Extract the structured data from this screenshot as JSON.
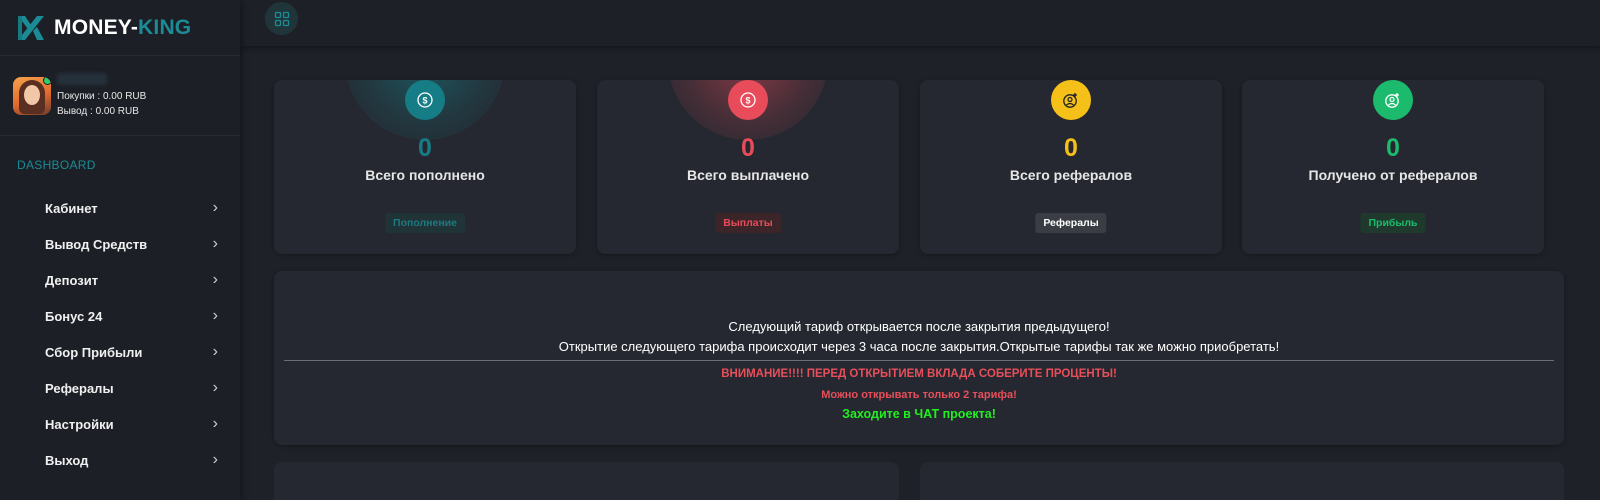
{
  "brand": {
    "name_main": "MONEY-",
    "name_accent": "KING"
  },
  "user": {
    "purchases": "Покупки : 0.00 RUB",
    "withdraw": "Вывод : 0.00 RUB"
  },
  "sidebar": {
    "section_title": "DASHBOARD",
    "items": [
      {
        "label": "Кабинет"
      },
      {
        "label": "Вывод Средств"
      },
      {
        "label": "Депозит"
      },
      {
        "label": "Бонус 24"
      },
      {
        "label": "Сбор Прибыли"
      },
      {
        "label": "Рефералы"
      },
      {
        "label": "Настройки"
      },
      {
        "label": "Выход"
      }
    ],
    "chevron": "›"
  },
  "topbar": {
    "icon": "grid-icon"
  },
  "stats": [
    {
      "value": "0",
      "label": "Всего пополнено",
      "button": "Пополнение",
      "icon": "dollar-coin-icon",
      "color": "#167d86"
    },
    {
      "value": "0",
      "label": "Всего выплачено",
      "button": "Выплаты",
      "icon": "dollar-coin-icon",
      "color": "#e84c5a"
    },
    {
      "value": "0",
      "label": "Всего рефералов",
      "button": "Рефералы",
      "icon": "user-add-icon",
      "color": "#f5c118"
    },
    {
      "value": "0",
      "label": "Получено от рефералов",
      "button": "Прибыль",
      "icon": "user-add-icon",
      "color": "#1cba6c"
    }
  ],
  "notice": {
    "line1": "Следующий тариф открывается после закрытия предыдущего!",
    "line2": "Открытие следующего тарифа происходит через 3 часа после закрытия.Открытые тарифы так же можно приобретать!",
    "warning1": "ВНИМАНИЕ!!!! ПЕРЕД ОТКРЫТИЕМ ВКЛАДА СОБЕРИТЕ ПРОЦЕНТЫ!",
    "warning2": "Можно открывать только 2 тарифа!",
    "chat": "Заходите в ЧАТ проекта!"
  },
  "colors": {
    "accent": "#1b8c95",
    "warning": "#e74f5a",
    "chat": "#22ee22",
    "background": "#1d2027",
    "card": "#252830"
  }
}
